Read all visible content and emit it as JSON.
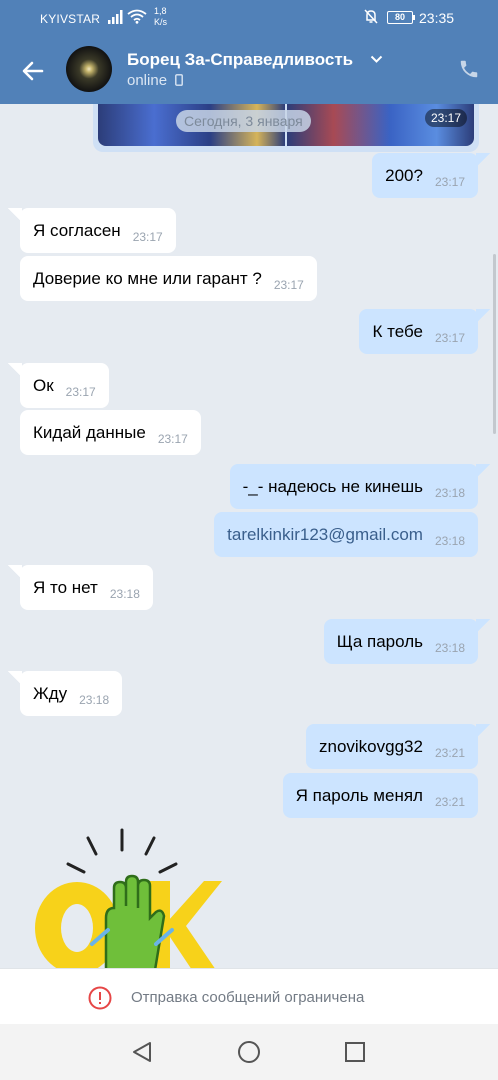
{
  "status_bar": {
    "carrier": "KYIVSTAR",
    "speed_line1": "1,8",
    "speed_line2": "K/s",
    "battery": "80",
    "time": "23:35"
  },
  "header": {
    "title": "Борец За-Справедливость",
    "subtitle": "online"
  },
  "media_message": {
    "date_label": "Сегодня, 3 января",
    "time": "23:17"
  },
  "messages": [
    {
      "dir": "out",
      "text": "200?",
      "time": "23:17"
    },
    {
      "dir": "in",
      "text": "Я согласен",
      "time": "23:17"
    },
    {
      "dir": "in",
      "text": "Доверие ко мне или гарант ?",
      "time": "23:17"
    },
    {
      "dir": "out",
      "text": "К тебе",
      "time": "23:17"
    },
    {
      "dir": "in",
      "text": "Ок",
      "time": "23:17"
    },
    {
      "dir": "in",
      "text": "Кидай данные",
      "time": "23:17"
    },
    {
      "dir": "out",
      "text": "-_- надеюсь не кинешь",
      "time": "23:18"
    },
    {
      "dir": "out",
      "text": "tarelkinkir123@gmail.com",
      "time": "23:18"
    },
    {
      "dir": "in",
      "text": "Я то нет",
      "time": "23:18"
    },
    {
      "dir": "out",
      "text": "Ща пароль",
      "time": "23:18"
    },
    {
      "dir": "in",
      "text": "Жду",
      "time": "23:18"
    },
    {
      "dir": "out",
      "text": "znovikovgg32",
      "time": "23:21"
    },
    {
      "dir": "out",
      "text": "Я пароль менял",
      "time": "23:21"
    }
  ],
  "restriction": {
    "text": "Отправка сообщений ограничена"
  },
  "colors": {
    "header": "#5181b8",
    "incoming": "#ffffff",
    "outgoing": "#cce4ff",
    "background": "#e6ebf1",
    "sticker_yellow": "#f7d21a",
    "sticker_green": "#6fbf3a"
  },
  "icons": [
    "back-arrow-icon",
    "chevron-down-icon",
    "phone-icon",
    "warning-icon",
    "nav-back-icon",
    "nav-home-icon",
    "nav-recents-icon"
  ]
}
